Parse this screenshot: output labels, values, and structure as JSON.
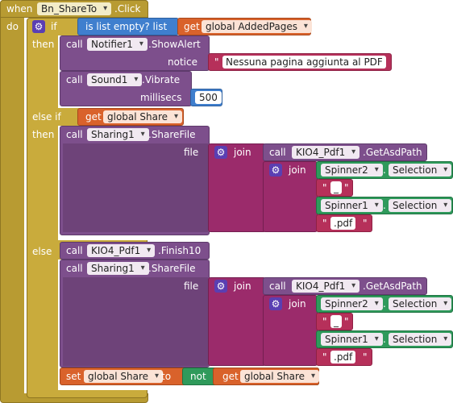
{
  "kw": {
    "when": "when",
    "do": "do",
    "if": "if",
    "then": "then",
    "else_if": "else if",
    "else": "else",
    "call": "call",
    "get": "get",
    "set": "set",
    "to": "to",
    "not": "not",
    "join": "join",
    "file": "file",
    "notice": "notice",
    "millisecs": "millisecs",
    "dot": ".",
    "quote_open": "\"",
    "quote_close": "\""
  },
  "event": {
    "component": "Bn_ShareTo",
    "event": ".Click"
  },
  "cond": {
    "label": "is list empty?  list",
    "var": "global AddedPages"
  },
  "notifier": {
    "component": "Notifier1",
    "method": ".ShowAlert",
    "notice": "Nessuna pagina aggiunta al PDF"
  },
  "sound": {
    "component": "Sound1",
    "method": ".Vibrate",
    "millisecs": "500"
  },
  "elseif_var": "global Share",
  "sharing": {
    "component": "Sharing1",
    "method": ".ShareFile"
  },
  "kio": {
    "component": "KIO4_Pdf1",
    "method": ".GetAsdPath",
    "finish": ".Finish10"
  },
  "spinner2": {
    "component": "Spinner2",
    "prop": "Selection"
  },
  "spinner1": {
    "component": "Spinner1",
    "prop": "Selection"
  },
  "sep": "_",
  "ext": ".pdf",
  "set_var": "global Share",
  "set_get_var": "global Share"
}
